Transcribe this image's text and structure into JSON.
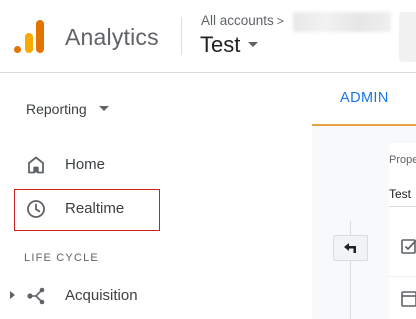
{
  "header": {
    "app_name": "Analytics",
    "breadcrumb": "All accounts",
    "breadcrumb_chevron": ">",
    "property_name": "Test"
  },
  "sidebar": {
    "reporting_label": "Reporting",
    "items": [
      {
        "label": "Home",
        "icon": "home-icon"
      },
      {
        "label": "Realtime",
        "icon": "clock-icon"
      }
    ],
    "section_label": "LIFE CYCLE",
    "lifecycle_items": [
      {
        "label": "Acquisition",
        "icon": "acquisition-icon"
      }
    ]
  },
  "main": {
    "active_tab": "ADMIN",
    "property_heading": "Prope",
    "property_value": "Test"
  },
  "colors": {
    "brand_orange": "#e37400",
    "brand_yellow": "#f9ab00",
    "accent_blue": "#1a73e8",
    "tab_underline": "#e8a33d",
    "highlight_red": "#c5221f"
  }
}
